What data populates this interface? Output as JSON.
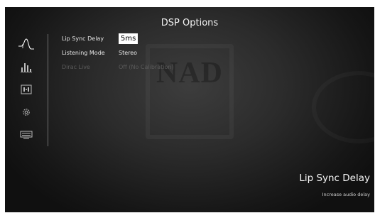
{
  "screen": {
    "title": "DSP Options"
  },
  "sidebar": {
    "items": [
      {
        "icon": "audio-curve-icon",
        "active": true
      },
      {
        "icon": "speaker-levels-icon"
      },
      {
        "icon": "room-speakers-icon"
      },
      {
        "icon": "settings-gear-icon"
      },
      {
        "icon": "display-icon"
      }
    ]
  },
  "options": {
    "lip_sync": {
      "label": "Lip Sync Delay",
      "value": "5ms"
    },
    "listening_mode": {
      "label": "Listening Mode",
      "value": "Stereo"
    },
    "dirac_live": {
      "label": "Dirac Live",
      "value": "Off (No Calibration)"
    }
  },
  "help": {
    "title": "Lip Sync Delay",
    "text": "Increase audio delay"
  },
  "background": {
    "logo": "NAD"
  },
  "colors": {
    "bg": "#2b2b2b",
    "text": "#e6e6e6",
    "disabled": "#5b5b5b",
    "selected_bg": "#ffffff"
  }
}
